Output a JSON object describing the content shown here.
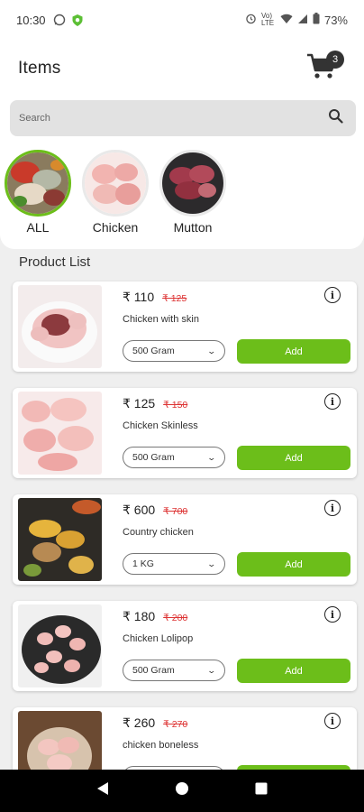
{
  "status_bar": {
    "time": "10:30",
    "network_label": "Vo) LTE",
    "battery_pct": "73%"
  },
  "header": {
    "title": "Items",
    "cart_count": "3"
  },
  "search": {
    "placeholder": "Search"
  },
  "categories": [
    {
      "label": "ALL",
      "active": true
    },
    {
      "label": "Chicken",
      "active": false
    },
    {
      "label": "Mutton",
      "active": false
    }
  ],
  "product_section": {
    "title": "Product List"
  },
  "products": [
    {
      "price": "₹ 110",
      "mrp": "₹ 125",
      "name": "Chicken with skin",
      "unit": "500 Gram",
      "add_label": "Add"
    },
    {
      "price": "₹ 125",
      "mrp": "₹ 150",
      "name": "Chicken Skinless",
      "unit": "500 Gram",
      "add_label": "Add"
    },
    {
      "price": "₹ 600",
      "mrp": "₹ 700",
      "name": "Country chicken",
      "unit": "1 KG",
      "add_label": "Add"
    },
    {
      "price": "₹ 180",
      "mrp": "₹ 200",
      "name": "Chicken Lolipop",
      "unit": "500 Gram",
      "add_label": "Add"
    },
    {
      "price": "₹ 260",
      "mrp": "₹ 270",
      "name": "chicken boneless",
      "unit": "",
      "add_label": ""
    }
  ],
  "colors": {
    "accent": "#6cbe1a",
    "strike_price": "#dd3333",
    "search_bg": "#e2e2e2"
  }
}
